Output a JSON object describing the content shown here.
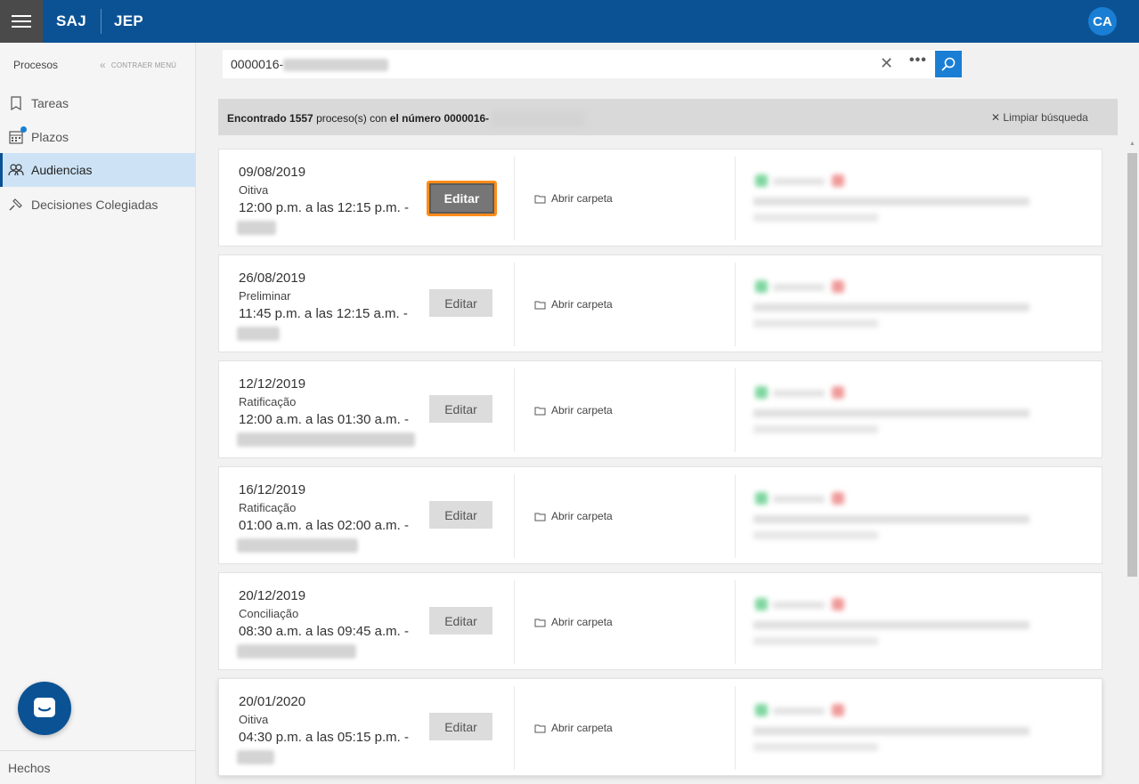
{
  "header": {
    "brand_primary": "SAJ",
    "brand_secondary": "JEP",
    "user_initials": "CA"
  },
  "sidebar": {
    "title": "Procesos",
    "collapse_label": "CONTRAER MENÚ",
    "items": [
      {
        "label": "Tareas",
        "icon": "bookmark-icon"
      },
      {
        "label": "Plazos",
        "icon": "calendar-icon"
      },
      {
        "label": "Audiencias",
        "icon": "people-icon",
        "active": true
      },
      {
        "label": "Decisiones Colegiadas",
        "icon": "gavel-icon"
      }
    ],
    "footer": "Hechos"
  },
  "search": {
    "value": "0000016-"
  },
  "results": {
    "prefix": "Encontrado",
    "count": "1557",
    "middle": "proceso(s) con",
    "suffix": "el número 0000016-",
    "clear_label": "Limpiar búsqueda"
  },
  "hearings": [
    {
      "date": "09/08/2019",
      "type": "Oitiva",
      "time": "12:00 p.m. a las 12:15 p.m. -",
      "edit": "Editar",
      "open": "Abrir carpeta"
    },
    {
      "date": "26/08/2019",
      "type": "Preliminar",
      "time": "11:45 p.m. a las 12:15 a.m. -",
      "edit": "Editar",
      "open": "Abrir carpeta"
    },
    {
      "date": "12/12/2019",
      "type": "Ratificação",
      "time": "12:00 a.m. a las 01:30 a.m. -",
      "edit": "Editar",
      "open": "Abrir carpeta"
    },
    {
      "date": "16/12/2019",
      "type": "Ratificação",
      "time": "01:00 a.m. a las 02:00 a.m. -",
      "edit": "Editar",
      "open": "Abrir carpeta"
    },
    {
      "date": "20/12/2019",
      "type": "Conciliação",
      "time": "08:30 a.m. a las 09:45 a.m. -",
      "edit": "Editar",
      "open": "Abrir carpeta"
    },
    {
      "date": "20/01/2020",
      "type": "Oitiva",
      "time": "04:30 p.m. a las 05:15 p.m. -",
      "edit": "Editar",
      "open": "Abrir carpeta"
    }
  ],
  "colors": {
    "header": "#0b5294",
    "accent": "#1a7fd4",
    "focus_ring": "#ff8c1a"
  }
}
